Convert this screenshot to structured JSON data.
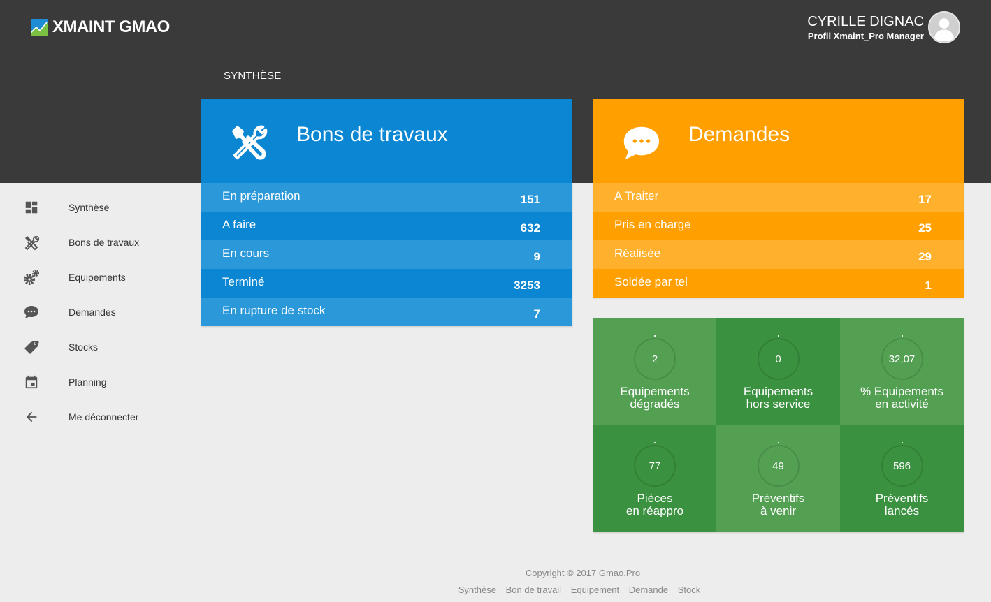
{
  "app": {
    "logo_text": "XMAINT GMAO",
    "user_name": "CYRILLE DIGNAC",
    "user_profile": "Profil Xmaint_Pro Manager",
    "page_title": "SYNTHÈSE"
  },
  "sidebar": {
    "items": [
      {
        "label": "Synthèse",
        "icon": "dashboard-icon"
      },
      {
        "label": "Bons de travaux",
        "icon": "tools-icon"
      },
      {
        "label": "Equipements",
        "icon": "gears-icon"
      },
      {
        "label": "Demandes",
        "icon": "chat-icon"
      },
      {
        "label": "Stocks",
        "icon": "tag-icon"
      },
      {
        "label": "Planning",
        "icon": "calendar-icon"
      },
      {
        "label": "Me déconnecter",
        "icon": "arrow-left-icon"
      }
    ]
  },
  "bons": {
    "title": "Bons de travaux",
    "rows": [
      {
        "label": "En préparation",
        "value": "151"
      },
      {
        "label": "A faire",
        "value": "632"
      },
      {
        "label": "En cours",
        "value": "9"
      },
      {
        "label": "Terminé",
        "value": "3253"
      },
      {
        "label": "En rupture de stock",
        "value": "7"
      }
    ]
  },
  "demandes": {
    "title": "Demandes",
    "rows": [
      {
        "label": "A Traiter",
        "value": "17"
      },
      {
        "label": "Pris en charge",
        "value": "25"
      },
      {
        "label": "Réalisée",
        "value": "29"
      },
      {
        "label": "Soldée par tel",
        "value": "1"
      }
    ]
  },
  "stats": {
    "tiles": [
      {
        "value": "2",
        "line1": "Equipements",
        "line2": "dégradés"
      },
      {
        "value": "0",
        "line1": "Equipements",
        "line2": "hors service"
      },
      {
        "value": "32,07",
        "line1": "% Equipements",
        "line2": "en activité"
      },
      {
        "value": "77",
        "line1": "Pièces",
        "line2": "en réappro"
      },
      {
        "value": "49",
        "line1": "Préventifs",
        "line2": "à venir"
      },
      {
        "value": "596",
        "line1": "Préventifs",
        "line2": "lancés"
      }
    ]
  },
  "footer": {
    "copyright": "Copyright © 2017 Gmao.Pro",
    "links": [
      "Synthèse",
      "Bon de travail",
      "Equipement",
      "Demande",
      "Stock"
    ]
  },
  "colors": {
    "header_bg": "#3a3a3a",
    "blue": "#0a86d2",
    "blue_light": "#2a98d9",
    "orange": "#ffa000",
    "orange_light": "#ffb12e",
    "green_dark": "#3a913f",
    "green_light": "#53a053"
  }
}
